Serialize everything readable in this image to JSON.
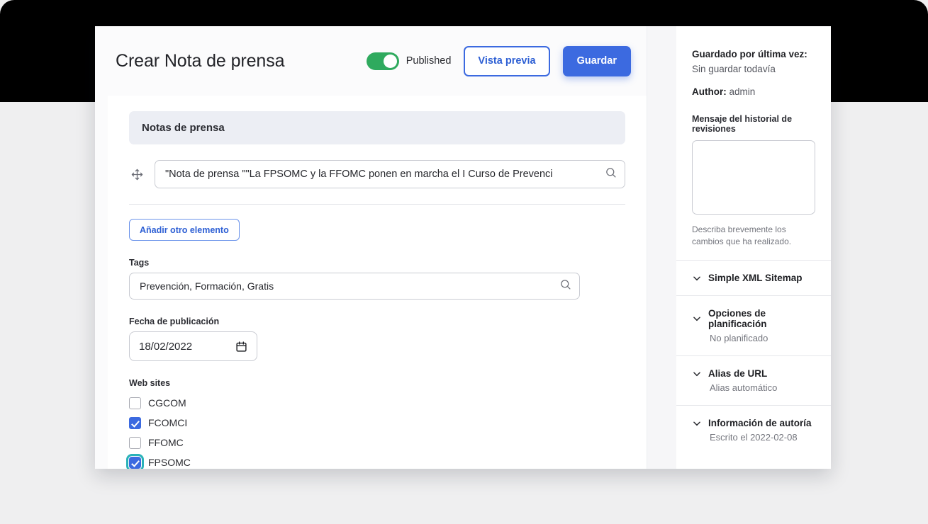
{
  "header": {
    "title": "Crear Nota de prensa",
    "toggle_label": "Published",
    "toggle_state": "on",
    "preview_label": "Vista previa",
    "save_label": "Guardar",
    "accent_color": "#3c6ae0",
    "toggle_color": "#2faa5e"
  },
  "main": {
    "section_title": "Notas de prensa",
    "reference_value": "\"Nota de prensa \"\"La FPSOMC y la FFOMC ponen en marcha el I Curso de Prevenci",
    "reference_placeholder": "",
    "add_another_label": "Añadir otro elemento",
    "tags": {
      "label": "Tags",
      "value": "Prevención, Formación, Gratis",
      "placeholder": ""
    },
    "publish_date": {
      "label": "Fecha de publicación",
      "value": "18/02/2022"
    },
    "websites": {
      "label": "Web sites",
      "options": [
        {
          "label": "CGCOM",
          "checked": false,
          "focused": false
        },
        {
          "label": "FCOMCI",
          "checked": true,
          "focused": false
        },
        {
          "label": "FFOMC",
          "checked": false,
          "focused": false
        },
        {
          "label": "FPSOMC",
          "checked": true,
          "focused": true
        }
      ]
    }
  },
  "sidebar": {
    "last_saved_label": "Guardado por última vez:",
    "last_saved_value": "Sin guardar todavía",
    "author_label": "Author:",
    "author_value": "admin",
    "revision_label": "Mensaje del historial de revisiones",
    "revision_value": "",
    "revision_help": "Describa brevemente los cambios que ha realizado.",
    "sections": [
      {
        "title": "Simple XML Sitemap",
        "subtitle": ""
      },
      {
        "title": "Opciones de planificación",
        "subtitle": "No planificado"
      },
      {
        "title": "Alias de URL",
        "subtitle": "Alias automático"
      },
      {
        "title": "Información de autoría",
        "subtitle": "Escrito el 2022-02-08"
      }
    ]
  },
  "icons": {
    "drag": "move-icon",
    "search": "search-icon",
    "calendar": "calendar-icon",
    "chevron": "chevron-down-icon"
  }
}
